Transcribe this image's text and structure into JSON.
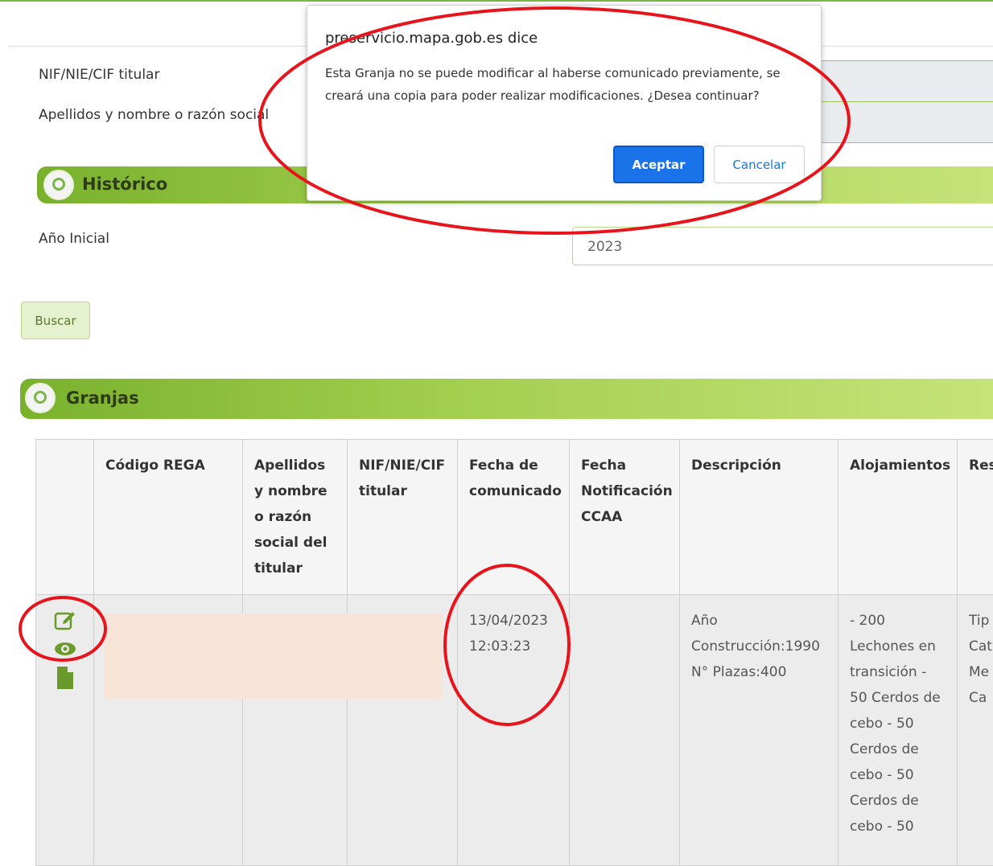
{
  "form": {
    "nif_label": "NIF/NIE/CIF titular",
    "name_label": "Apellidos y nombre o razón social"
  },
  "historico": {
    "title": "Histórico",
    "year_label": "Año Inicial",
    "year_value": "2023",
    "search_label": "Buscar"
  },
  "granjas": {
    "title": "Granjas",
    "columns": [
      "",
      "Código REGA",
      "Apellidos y nombre o razón social del titular",
      "NIF/NIE/CIF titular",
      "Fecha de comunicado",
      "Fecha Notificación CCAA",
      "Descripción",
      "Alojamientos",
      "Res"
    ],
    "row": {
      "fecha_comunicado": "13/04/2023 12:03:23",
      "descripcion": "Año Construcción:1990 N° Plazas:400",
      "alojamientos": "- 200 Lechones en transición - 50 Cerdos de cebo - 50 Cerdos de cebo - 50 Cerdos de cebo - 50",
      "res": "Tip Cat Me Hu Ca"
    },
    "icons": [
      "edit-icon",
      "view-icon",
      "document-icon"
    ]
  },
  "dialog": {
    "host": "preservicio.mapa.gob.es dice",
    "message": "Esta Granja no se puede modificar al haberse comunicado previamente, se creará una copia para poder realizar modificaciones. ¿Desea continuar?",
    "accept_label": "Aceptar",
    "cancel_label": "Cancelar"
  },
  "colors": {
    "brand_green": "#7ab648",
    "primary_blue": "#1a73e8",
    "annotation_red": "#e8141b"
  }
}
